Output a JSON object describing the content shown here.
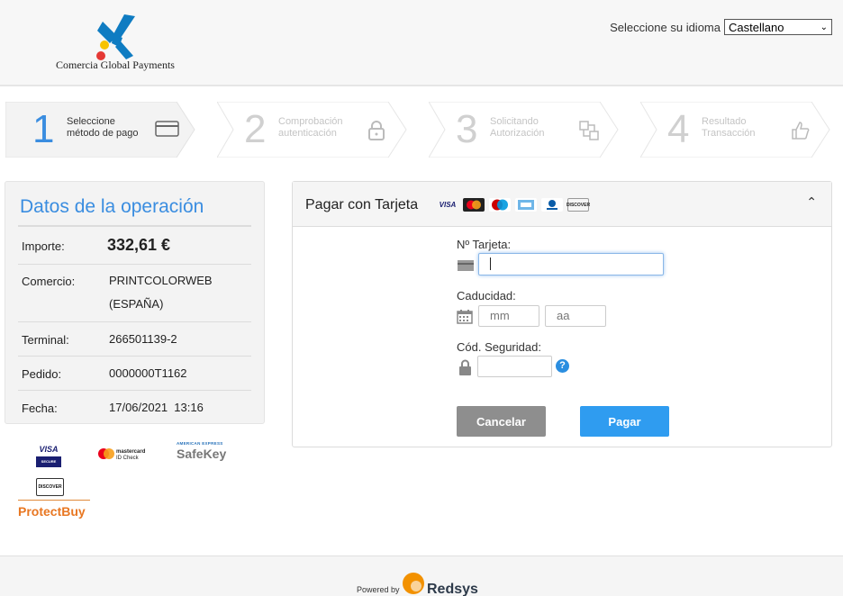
{
  "header": {
    "logo_text": "Comercia Global Payments",
    "language_label": "Seleccione su idioma",
    "language_selected": "Castellano"
  },
  "steps": [
    {
      "number": "1",
      "label": "Seleccione\nmétodo de pago",
      "icon": "card-icon",
      "active": true
    },
    {
      "number": "2",
      "label": "Comprobación\nautenticación",
      "icon": "lock-icon",
      "active": false
    },
    {
      "number": "3",
      "label": "Solicitando\nAutorización",
      "icon": "exchange-icon",
      "active": false
    },
    {
      "number": "4",
      "label": "Resultado\nTransacción",
      "icon": "thumbs-up-icon",
      "active": false
    }
  ],
  "operation": {
    "title": "Datos de la operación",
    "rows": [
      {
        "key": "Importe:",
        "value": "332,61 €"
      },
      {
        "key": "Comercio:",
        "value": "PRINTCOLORWEB\n(ESPAÑA)"
      },
      {
        "key": "Terminal:",
        "value": "266501139-2"
      },
      {
        "key": "Pedido:",
        "value": "0000000T1162"
      },
      {
        "key": "Fecha:",
        "value": "17/06/2021  13:16"
      }
    ]
  },
  "payment": {
    "title": "Pagar con Tarjeta",
    "brands": [
      "VISA",
      "Mastercard",
      "Maestro",
      "AMEX",
      "Diners",
      "DISCOVER"
    ],
    "card_number_label": "Nº Tarjeta:",
    "card_number_value": "",
    "expiry_label": "Caducidad:",
    "month_placeholder": "mm",
    "year_placeholder": "aa",
    "cvv_label": "Cód. Seguridad:",
    "cvv_value": "",
    "help_glyph": "?",
    "cancel_label": "Cancelar",
    "pay_label": "Pagar",
    "collapse_glyph": "⌃"
  },
  "security_logos": {
    "visa_secure": "VISA",
    "visa_secure_sub": "SECURE",
    "mastercard_idcheck": "mastercard",
    "mastercard_idcheck_sub": "ID Check",
    "amex_top": "AMERICAN EXPRESS",
    "amex_safekey": "SafeKey",
    "discover": "DISCOVER",
    "protectbuy": "ProtectBuy"
  },
  "footer": {
    "powered_by": "Powered by",
    "brand": "Redsys"
  },
  "colors": {
    "accent_blue": "#3a8de0",
    "pay_button": "#2f9cf0",
    "cancel_button": "#8e8e8e"
  }
}
